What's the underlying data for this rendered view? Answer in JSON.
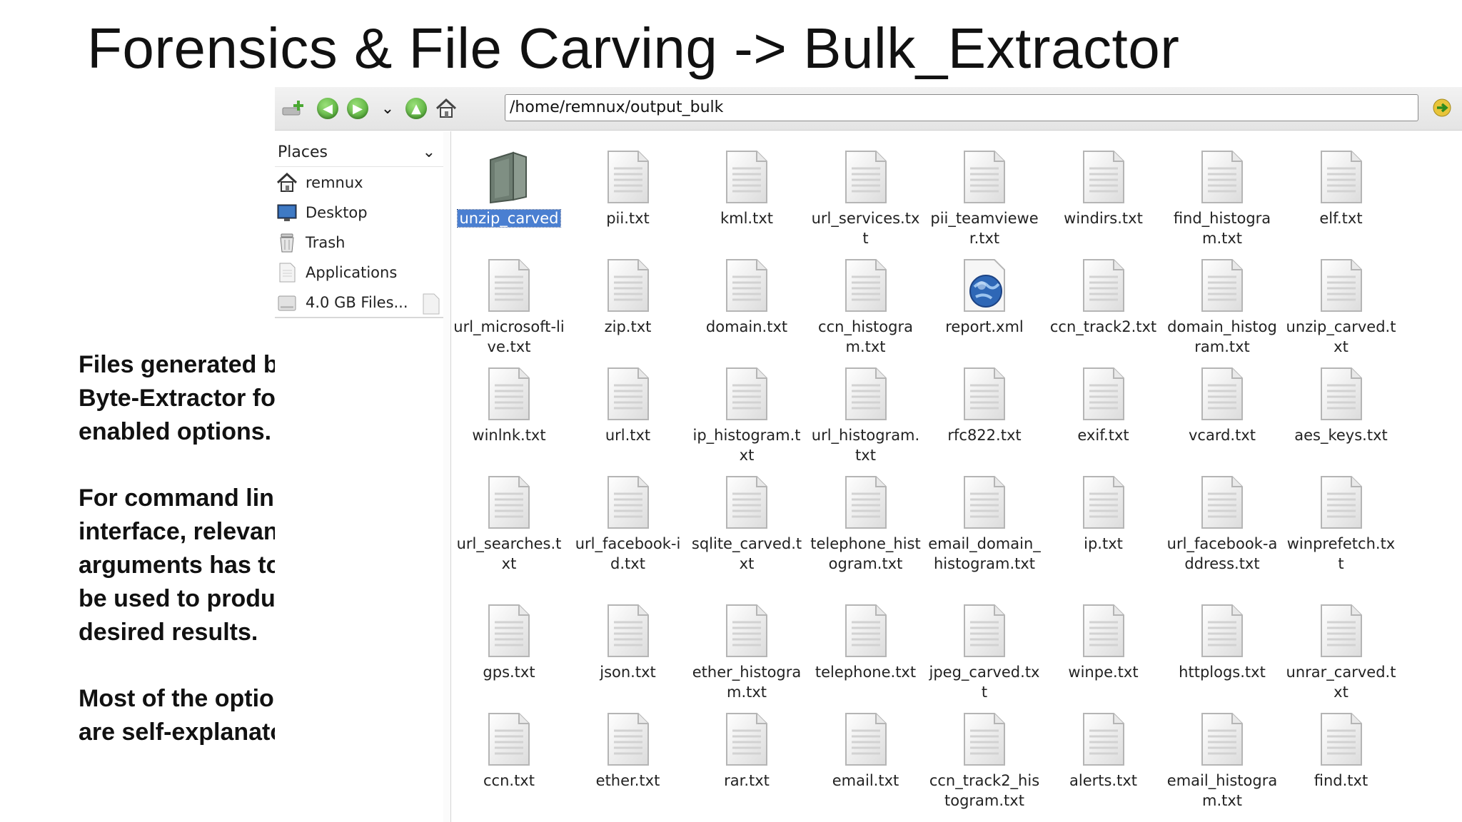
{
  "slide": {
    "title": "Forensics & File Carving -> Bulk_Extractor",
    "notes": [
      "Files generated by Byte-Extractor for enabled options.",
      "For command line interface, relevant arguments has to be used to produce desired results.",
      "Most of the options are self-explanatory."
    ]
  },
  "toolbar": {
    "address": "/home/remnux/output_bulk",
    "icons": [
      "new-tab-icon",
      "back-icon",
      "forward-icon",
      "history-dropdown-icon",
      "up-icon",
      "home-icon",
      "go-icon"
    ]
  },
  "sidebar": {
    "header": "Places",
    "items": [
      {
        "label": "remnux",
        "icon": "home-icon"
      },
      {
        "label": "Desktop",
        "icon": "desktop-icon"
      },
      {
        "label": "Trash",
        "icon": "trash-icon"
      },
      {
        "label": "Applications",
        "icon": "applications-icon"
      },
      {
        "label": "4.0 GB Files...",
        "icon": "drive-icon"
      }
    ]
  },
  "files": [
    {
      "name": "unzip_carved",
      "type": "folder",
      "selected": true
    },
    {
      "name": "pii.txt",
      "type": "text"
    },
    {
      "name": "kml.txt",
      "type": "text"
    },
    {
      "name": "url_services.txt",
      "type": "text"
    },
    {
      "name": "pii_teamviewer.txt",
      "type": "text"
    },
    {
      "name": "windirs.txt",
      "type": "text"
    },
    {
      "name": "find_histogram.txt",
      "type": "text"
    },
    {
      "name": "elf.txt",
      "type": "text"
    },
    {
      "name": "url_microsoft-live.txt",
      "type": "text"
    },
    {
      "name": "zip.txt",
      "type": "text"
    },
    {
      "name": "domain.txt",
      "type": "text"
    },
    {
      "name": "ccn_histogram.txt",
      "type": "text"
    },
    {
      "name": "report.xml",
      "type": "xml"
    },
    {
      "name": "ccn_track2.txt",
      "type": "text"
    },
    {
      "name": "domain_histogram.txt",
      "type": "text"
    },
    {
      "name": "unzip_carved.txt",
      "type": "text"
    },
    {
      "name": "winlnk.txt",
      "type": "text"
    },
    {
      "name": "url.txt",
      "type": "text"
    },
    {
      "name": "ip_histogram.txt",
      "type": "text"
    },
    {
      "name": "url_histogram.txt",
      "type": "text"
    },
    {
      "name": "rfc822.txt",
      "type": "text"
    },
    {
      "name": "exif.txt",
      "type": "text"
    },
    {
      "name": "vcard.txt",
      "type": "text"
    },
    {
      "name": "aes_keys.txt",
      "type": "text"
    },
    {
      "name": "url_searches.txt",
      "type": "text"
    },
    {
      "name": "url_facebook-id.txt",
      "type": "text"
    },
    {
      "name": "sqlite_carved.txt",
      "type": "text"
    },
    {
      "name": "telephone_histogram.txt",
      "type": "text"
    },
    {
      "name": "email_domain_histogram.txt",
      "type": "text"
    },
    {
      "name": "ip.txt",
      "type": "text"
    },
    {
      "name": "url_facebook-address.txt",
      "type": "text"
    },
    {
      "name": "winprefetch.txt",
      "type": "text"
    },
    {
      "name": "gps.txt",
      "type": "text"
    },
    {
      "name": "json.txt",
      "type": "text"
    },
    {
      "name": "ether_histogram.txt",
      "type": "text"
    },
    {
      "name": "telephone.txt",
      "type": "text"
    },
    {
      "name": "jpeg_carved.txt",
      "type": "text"
    },
    {
      "name": "winpe.txt",
      "type": "text"
    },
    {
      "name": "httplogs.txt",
      "type": "text"
    },
    {
      "name": "unrar_carved.txt",
      "type": "text"
    },
    {
      "name": "ccn.txt",
      "type": "text"
    },
    {
      "name": "ether.txt",
      "type": "text"
    },
    {
      "name": "rar.txt",
      "type": "text"
    },
    {
      "name": "email.txt",
      "type": "text"
    },
    {
      "name": "ccn_track2_histogram.txt",
      "type": "text"
    },
    {
      "name": "alerts.txt",
      "type": "text"
    },
    {
      "name": "email_histogram.txt",
      "type": "text"
    },
    {
      "name": "find.txt",
      "type": "text"
    }
  ]
}
